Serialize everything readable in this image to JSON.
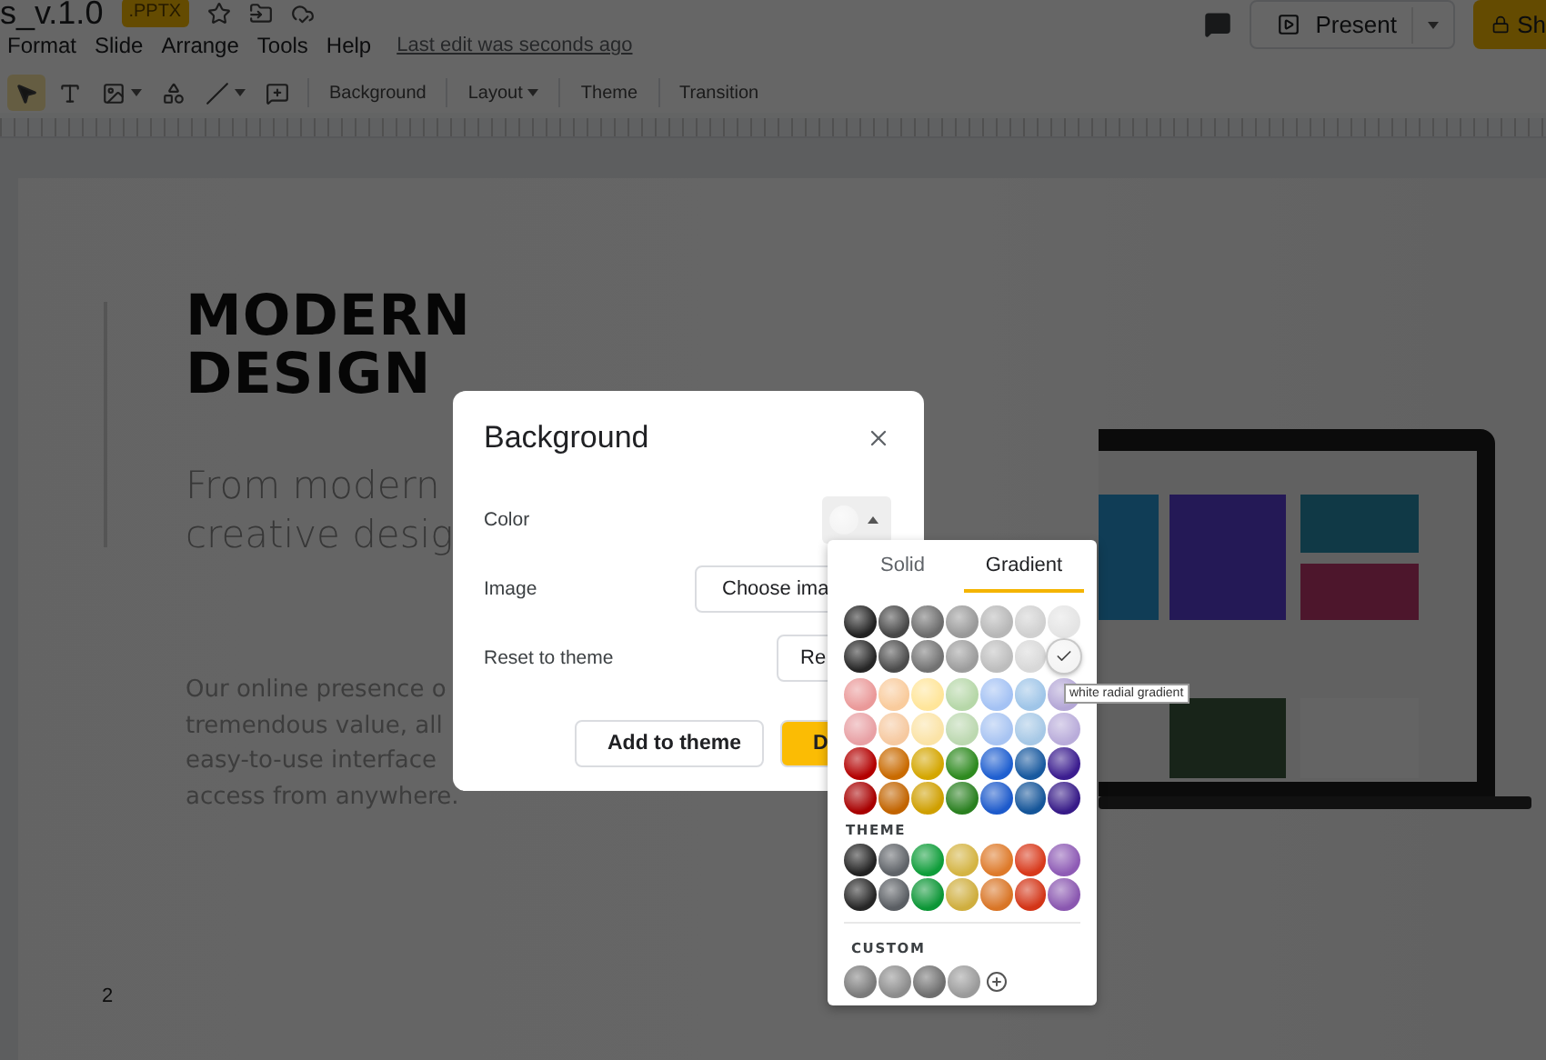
{
  "header": {
    "title": "s_v.1.0",
    "badge": ".PPTX",
    "present_button": "Present",
    "share_button": "Sh"
  },
  "menu": {
    "items": [
      "Format",
      "Slide",
      "Arrange",
      "Tools",
      "Help"
    ],
    "last_edit": "Last edit was seconds ago"
  },
  "toolbar": {
    "tools": [
      {
        "kind": "pointer",
        "selected": true
      },
      {
        "kind": "textbox",
        "selected": false
      },
      {
        "kind": "image",
        "selected": false
      },
      {
        "kind": "shape",
        "selected": false
      },
      {
        "kind": "line",
        "selected": false
      },
      {
        "kind": "comment",
        "selected": false
      }
    ],
    "buttons": [
      {
        "label": "Background",
        "dropdown": false
      },
      {
        "label": "Layout",
        "dropdown": true
      },
      {
        "label": "Theme",
        "dropdown": false
      },
      {
        "label": "Transition",
        "dropdown": false
      }
    ]
  },
  "slide": {
    "title_lines": [
      "MODERN",
      "DESIGN"
    ],
    "subtitle_lines": [
      "From modern",
      "creative desig"
    ],
    "body_lines": [
      "Our online presence o",
      "tremendous value, all",
      "easy-to-use interface",
      "access from anywhere."
    ],
    "page_number": "2"
  },
  "dialog": {
    "title": "Background",
    "rows": [
      {
        "kind": "color",
        "label": "Color"
      },
      {
        "kind": "button",
        "label": "Image",
        "button": "Choose ima"
      },
      {
        "kind": "button",
        "label": "Reset to theme",
        "button": "Re"
      }
    ],
    "secondary_button": "Add to theme",
    "primary_button": "D"
  },
  "color_menu": {
    "tabs": [
      {
        "label": "Solid",
        "selected": false
      },
      {
        "label": "Gradient",
        "selected": true
      }
    ],
    "main_rows": [
      [
        {
          "color": "#222222",
          "selected": false
        },
        {
          "color": "#474747",
          "selected": false
        },
        {
          "color": "#6c6c6c",
          "selected": false
        },
        {
          "color": "#999999",
          "selected": false
        },
        {
          "color": "#b7b7b7",
          "selected": false
        },
        {
          "color": "#d0d0d0",
          "selected": false
        },
        {
          "color": "#e4e4e4",
          "selected": false
        }
      ],
      [
        {
          "color": "#262626",
          "selected": false
        },
        {
          "color": "#4c4c4c",
          "selected": false
        },
        {
          "color": "#727272",
          "selected": false
        },
        {
          "color": "#9c9c9c",
          "selected": false
        },
        {
          "color": "#bdbdbd",
          "selected": false
        },
        {
          "color": "#d8d8d8",
          "selected": false
        },
        {
          "color": "#f4f4f4",
          "selected": true
        }
      ],
      [
        {
          "color": "#ea9999",
          "selected": false
        },
        {
          "color": "#f9cb9c",
          "selected": false
        },
        {
          "color": "#ffe599",
          "selected": false
        },
        {
          "color": "#b6d7a8",
          "selected": false
        },
        {
          "color": "#a4c2f4",
          "selected": false
        },
        {
          "color": "#9fc5e8",
          "selected": false
        },
        {
          "color": "#b4a7d6",
          "selected": false
        }
      ],
      [
        {
          "color": "#e8a0a4",
          "selected": false
        },
        {
          "color": "#f6c9a0",
          "selected": false
        },
        {
          "color": "#fbe3a6",
          "selected": false
        },
        {
          "color": "#bcd8b0",
          "selected": false
        },
        {
          "color": "#a8c4f2",
          "selected": false
        },
        {
          "color": "#a6c8e6",
          "selected": false
        },
        {
          "color": "#b9acda",
          "selected": false
        }
      ],
      [
        {
          "color": "#b30000",
          "selected": false
        },
        {
          "color": "#c96a00",
          "selected": false
        },
        {
          "color": "#d4a600",
          "selected": false
        },
        {
          "color": "#2e8a1f",
          "selected": false
        },
        {
          "color": "#1f5fd0",
          "selected": false
        },
        {
          "color": "#18599f",
          "selected": false
        },
        {
          "color": "#3b1d8f",
          "selected": false
        }
      ],
      [
        {
          "color": "#a80000",
          "selected": false
        },
        {
          "color": "#c26400",
          "selected": false
        },
        {
          "color": "#cf9f00",
          "selected": false
        },
        {
          "color": "#2a8020",
          "selected": false
        },
        {
          "color": "#1d5acb",
          "selected": false
        },
        {
          "color": "#155599",
          "selected": false
        },
        {
          "color": "#371b88",
          "selected": false
        }
      ]
    ],
    "theme_heading": "THEME",
    "theme_rows": [
      [
        {
          "color": "#222222",
          "selected": false
        },
        {
          "color": "#5f6368",
          "selected": false
        },
        {
          "color": "#0f9d3a",
          "selected": false
        },
        {
          "color": "#d4b443",
          "selected": false
        },
        {
          "color": "#de7a2a",
          "selected": false
        },
        {
          "color": "#d8391b",
          "selected": false
        },
        {
          "color": "#8e5bb5",
          "selected": false
        }
      ],
      [
        {
          "color": "#262626",
          "selected": false
        },
        {
          "color": "#5a5e63",
          "selected": false
        },
        {
          "color": "#0c9636",
          "selected": false
        },
        {
          "color": "#cfae3e",
          "selected": false
        },
        {
          "color": "#d97526",
          "selected": false
        },
        {
          "color": "#d33517",
          "selected": false
        },
        {
          "color": "#8a57b0",
          "selected": false
        }
      ]
    ],
    "custom_heading": "CUSTOM",
    "custom_swatches": [
      {
        "color": "#7a7a7a",
        "selected": false
      },
      {
        "color": "#8c8c8c",
        "selected": false
      },
      {
        "color": "#6e6e6e",
        "selected": false
      },
      {
        "color": "#9a9a9a",
        "selected": false
      }
    ],
    "tooltip": "white radial gradient"
  }
}
